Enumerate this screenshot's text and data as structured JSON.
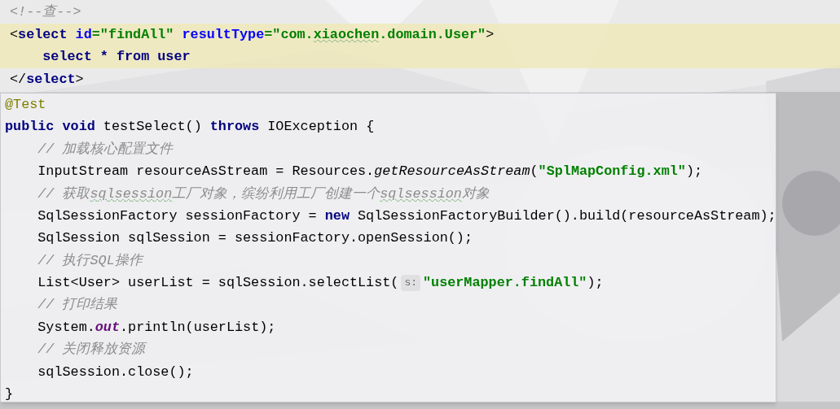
{
  "xml_editor": {
    "lines": [
      {
        "highlighted": false,
        "tokens": [
          {
            "kind": "comment",
            "text": "<!--查-->"
          }
        ]
      },
      {
        "highlighted": true,
        "tokens": [
          {
            "kind": "plain",
            "text": "<"
          },
          {
            "kind": "tag",
            "text": "select "
          },
          {
            "kind": "attr",
            "text": "id"
          },
          {
            "kind": "string",
            "text": "=\"findAll\" "
          },
          {
            "kind": "attr",
            "text": "resultType"
          },
          {
            "kind": "string",
            "text": "=\"com."
          },
          {
            "kind": "string",
            "text": "xiaochen",
            "typo": true
          },
          {
            "kind": "string",
            "text": ".domain.User\""
          },
          {
            "kind": "plain",
            "text": ">"
          }
        ]
      },
      {
        "highlighted": true,
        "tokens": [
          {
            "kind": "tag",
            "text": "    select * from user"
          }
        ]
      },
      {
        "highlighted": false,
        "tokens": [
          {
            "kind": "plain",
            "text": "</"
          },
          {
            "kind": "tag",
            "text": "select"
          },
          {
            "kind": "plain",
            "text": ">"
          }
        ]
      }
    ]
  },
  "java_popup": {
    "lines": [
      {
        "tokens": [
          {
            "kind": "annotation",
            "text": "@Test"
          }
        ]
      },
      {
        "tokens": [
          {
            "kind": "keyword",
            "text": "public void"
          },
          {
            "kind": "plain",
            "text": " testSelect() "
          },
          {
            "kind": "keyword",
            "text": "throws"
          },
          {
            "kind": "plain",
            "text": " IOException {"
          }
        ]
      },
      {
        "tokens": [
          {
            "kind": "comment",
            "text": "    // 加载核心配置文件"
          }
        ]
      },
      {
        "tokens": [
          {
            "kind": "plain",
            "text": "    InputStream resourceAsStream = Resources."
          },
          {
            "kind": "method",
            "text": "getResourceAsStream"
          },
          {
            "kind": "plain",
            "text": "("
          },
          {
            "kind": "string",
            "text": "\"SplMapConfig.xml\""
          },
          {
            "kind": "plain",
            "text": ");"
          }
        ]
      },
      {
        "tokens": [
          {
            "kind": "comment",
            "text": "    // 获取"
          },
          {
            "kind": "comment",
            "text": "sqlsession",
            "typo": true
          },
          {
            "kind": "comment",
            "text": "工厂对象，缤纷利用工厂创建一个"
          },
          {
            "kind": "comment",
            "text": "sqlsession",
            "typo": true
          },
          {
            "kind": "comment",
            "text": "对象"
          }
        ]
      },
      {
        "tokens": [
          {
            "kind": "plain",
            "text": "    SqlSessionFactory sessionFactory = "
          },
          {
            "kind": "keyword",
            "text": "new"
          },
          {
            "kind": "plain",
            "text": " SqlSessionFactoryBuilder().build(resourceAsStream);"
          }
        ]
      },
      {
        "tokens": [
          {
            "kind": "plain",
            "text": "    SqlSession sqlSession = sessionFactory.openSession();"
          }
        ]
      },
      {
        "tokens": [
          {
            "kind": "comment",
            "text": "    // 执行SQL操作"
          }
        ]
      },
      {
        "tokens": [
          {
            "kind": "plain",
            "text": "    List<User> userList = sqlSession.selectList("
          },
          {
            "kind": "hint",
            "text": "s:"
          },
          {
            "kind": "string",
            "text": "\"userMapper.findAll\""
          },
          {
            "kind": "plain",
            "text": ");"
          }
        ]
      },
      {
        "tokens": [
          {
            "kind": "comment",
            "text": "    // 打印结果"
          }
        ]
      },
      {
        "tokens": [
          {
            "kind": "plain",
            "text": "    System."
          },
          {
            "kind": "field",
            "text": "out"
          },
          {
            "kind": "plain",
            "text": ".println(userList);"
          }
        ]
      },
      {
        "tokens": [
          {
            "kind": "comment",
            "text": "    // 关闭释放资源"
          }
        ]
      },
      {
        "tokens": [
          {
            "kind": "plain",
            "text": "    sqlSession.close();"
          }
        ]
      },
      {
        "tokens": [
          {
            "kind": "plain",
            "text": "}"
          }
        ]
      }
    ]
  }
}
